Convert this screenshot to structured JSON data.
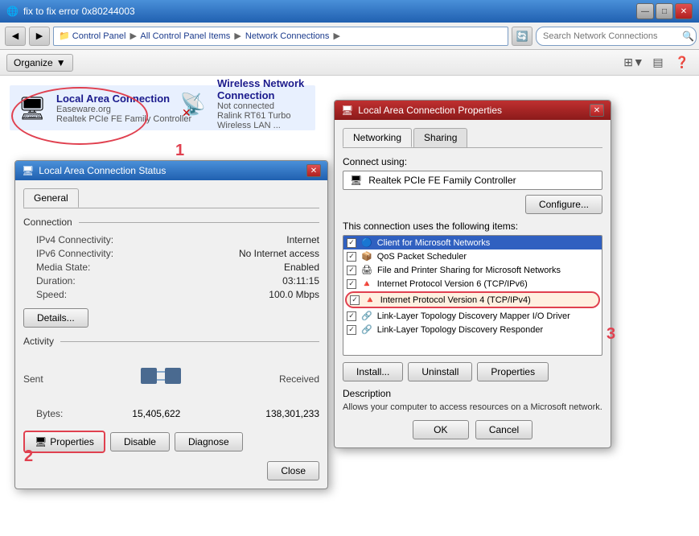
{
  "window": {
    "title": "fix to fix error 0x80244003",
    "min_btn": "—",
    "max_btn": "□",
    "close_btn": "✕"
  },
  "addressbar": {
    "back_btn": "◀",
    "forward_btn": "▶",
    "path": "Control Panel  ▶  All Control Panel Items  ▶  Network Connections  ▶",
    "search_placeholder": "Search Network Connections"
  },
  "toolbar": {
    "organize_label": "Organize",
    "organize_arrow": "▼"
  },
  "connections": [
    {
      "name": "Local Area Connection",
      "org": "Easeware.org",
      "adapter": "Realtek PCIe FE Family Controller",
      "status": "connected",
      "selected": true
    },
    {
      "name": "Wireless Network Connection",
      "org": "Not connected",
      "adapter": "Ralink RT61 Turbo Wireless LAN ...",
      "status": "disconnected",
      "selected": false
    }
  ],
  "status_dialog": {
    "title": "Local Area Connection Status",
    "tabs": [
      "General"
    ],
    "connection_section": "Connection",
    "rows": [
      {
        "label": "IPv4 Connectivity:",
        "value": "Internet"
      },
      {
        "label": "IPv6 Connectivity:",
        "value": "No Internet access"
      },
      {
        "label": "Media State:",
        "value": "Enabled"
      },
      {
        "label": "Duration:",
        "value": "03:11:15"
      },
      {
        "label": "Speed:",
        "value": "100.0 Mbps"
      }
    ],
    "details_btn": "Details...",
    "activity_section": "Activity",
    "sent_label": "Sent",
    "received_label": "Received",
    "bytes_label": "Bytes:",
    "sent_bytes": "15,405,622",
    "received_bytes": "138,301,233",
    "properties_btn": "Properties",
    "disable_btn": "Disable",
    "diagnose_btn": "Diagnose",
    "close_btn": "Close"
  },
  "props_dialog": {
    "title": "Local Area Connection Properties",
    "tabs": [
      "Networking",
      "Sharing"
    ],
    "connect_using_label": "Connect using:",
    "adapter_name": "Realtek PCIe FE Family Controller",
    "configure_btn": "Configure...",
    "items_label": "This connection uses the following items:",
    "items": [
      {
        "checked": true,
        "name": "Client for Microsoft Networks",
        "selected": true
      },
      {
        "checked": true,
        "name": "QoS Packet Scheduler",
        "selected": false
      },
      {
        "checked": true,
        "name": "File and Printer Sharing for Microsoft Networks",
        "selected": false
      },
      {
        "checked": true,
        "name": "Internet Protocol Version 6 (TCP/IPv6)",
        "selected": false
      },
      {
        "checked": true,
        "name": "Internet Protocol Version 4 (TCP/IPv4)",
        "selected": false,
        "oval": true
      },
      {
        "checked": true,
        "name": "Link-Layer Topology Discovery Mapper I/O Driver",
        "selected": false
      },
      {
        "checked": true,
        "name": "Link-Layer Topology Discovery Responder",
        "selected": false
      }
    ],
    "install_btn": "Install...",
    "uninstall_btn": "Uninstall",
    "properties_btn": "Properties",
    "description_label": "Description",
    "description_text": "Allows your computer to access resources on a Microsoft network.",
    "ok_btn": "OK",
    "cancel_btn": "Cancel"
  },
  "annotations": {
    "num1": "1",
    "num2": "2",
    "num3": "3"
  }
}
